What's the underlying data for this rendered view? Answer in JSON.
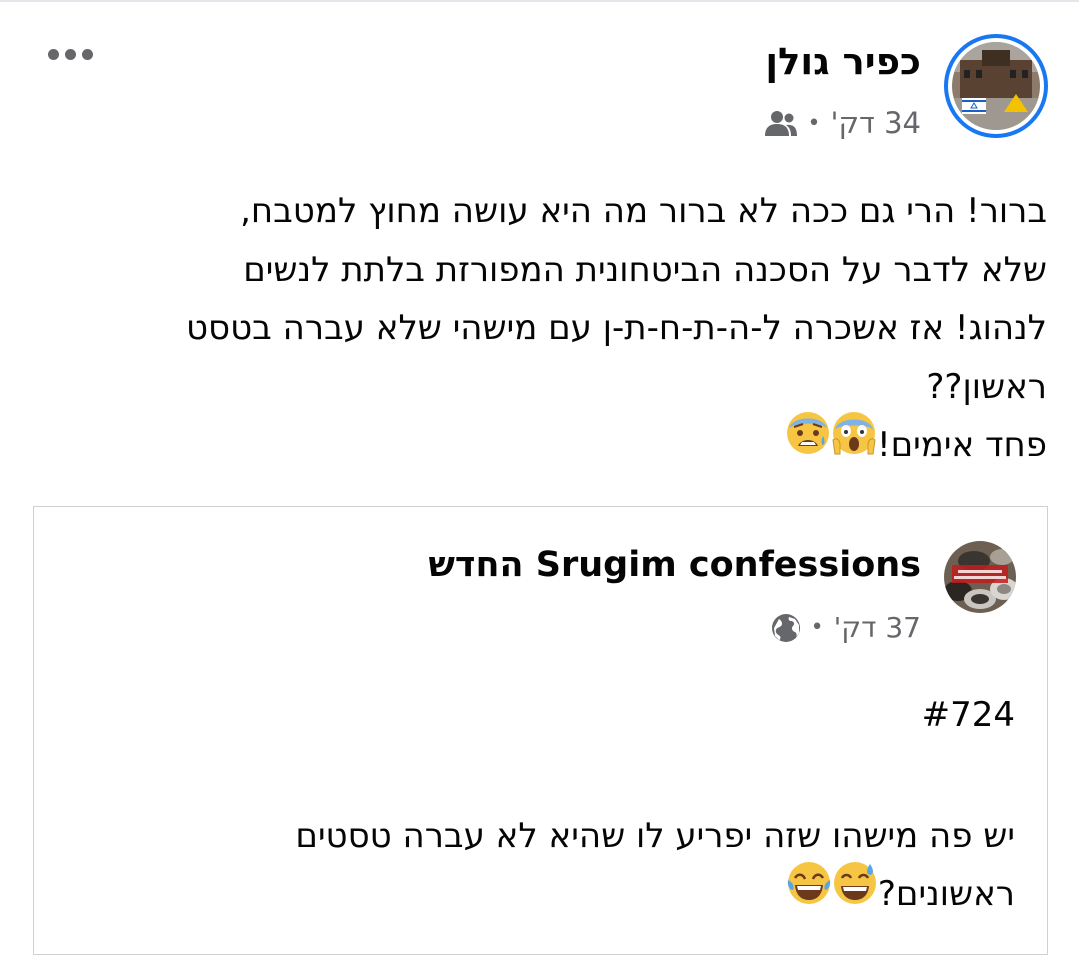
{
  "post": {
    "author": "כפיר גולן",
    "time": "34 דק'",
    "separator": "•",
    "audience_icon": "friends-icon",
    "more_icon": "more-options-icon",
    "text_body": "ברור! הרי גם ככה לא ברור מה היא עושה מחוץ למטבח,\nשלא לדבר על הסכנה הביטחונית המפורזת בלתת לנשים\nלנהוג! אז אשכרה ל-ה-ת-ח-ת-ן עם מישהי שלא עברה בטסט\nראשון??\n",
    "text_last": "פחד אימים!",
    "emojis_end": [
      "face-screaming-emoji",
      "anxious-face-emoji"
    ]
  },
  "shared": {
    "page_name": "Srugim confessions החדש",
    "time": "37 דק'",
    "separator": "•",
    "audience_icon": "globe-icon",
    "hashtag": "#724",
    "text_body": "יש פה מישהו שזה יפריע לו שהיא לא עברה טסטים\n",
    "text_last": "ראשונים?",
    "emojis_end": [
      "grinning-sweat-emoji",
      "tears-of-joy-emoji"
    ]
  },
  "colors": {
    "accent": "#1877f2",
    "secondary_text": "#65676b",
    "border": "#ced0d4"
  }
}
